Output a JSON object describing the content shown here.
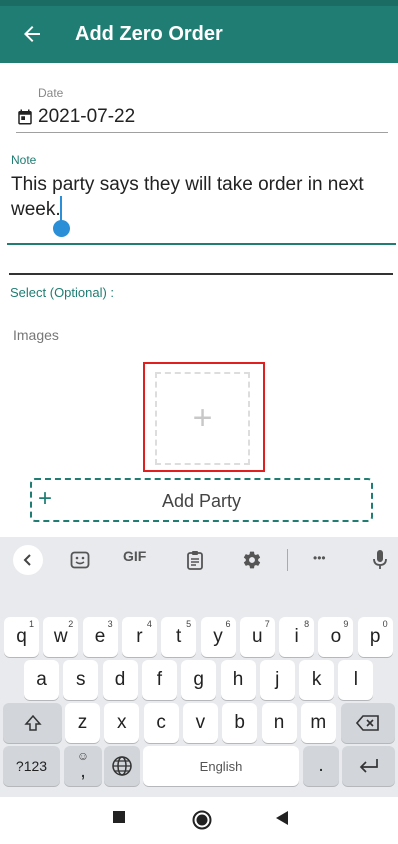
{
  "app_bar": {
    "title": "Add Zero Order"
  },
  "form": {
    "date_label": "Date",
    "date_value": "2021-07-22",
    "note_label": "Note",
    "note_value": "This party says they will take order in next week.",
    "select_label": "Select (Optional) :",
    "images_label": "Images",
    "add_image_symbol": "+",
    "add_party_label": "Add Party",
    "add_party_symbol": "+"
  },
  "keyboard": {
    "toolbar": {
      "gif": "GIF",
      "more": "•••"
    },
    "row1": [
      {
        "k": "q",
        "s": "1"
      },
      {
        "k": "w",
        "s": "2"
      },
      {
        "k": "e",
        "s": "3"
      },
      {
        "k": "r",
        "s": "4"
      },
      {
        "k": "t",
        "s": "5"
      },
      {
        "k": "y",
        "s": "6"
      },
      {
        "k": "u",
        "s": "7"
      },
      {
        "k": "i",
        "s": "8"
      },
      {
        "k": "o",
        "s": "9"
      },
      {
        "k": "p",
        "s": "0"
      }
    ],
    "row2": [
      "a",
      "s",
      "d",
      "f",
      "g",
      "h",
      "j",
      "k",
      "l"
    ],
    "row3": [
      "z",
      "x",
      "c",
      "v",
      "b",
      "n",
      "m"
    ],
    "symbols_key": "?123",
    "comma_key": ",",
    "space_label": "English",
    "period_key": "."
  },
  "colors": {
    "primary": "#1f7d73",
    "accent": "#2a8fd6",
    "highlight": "#e02020"
  }
}
